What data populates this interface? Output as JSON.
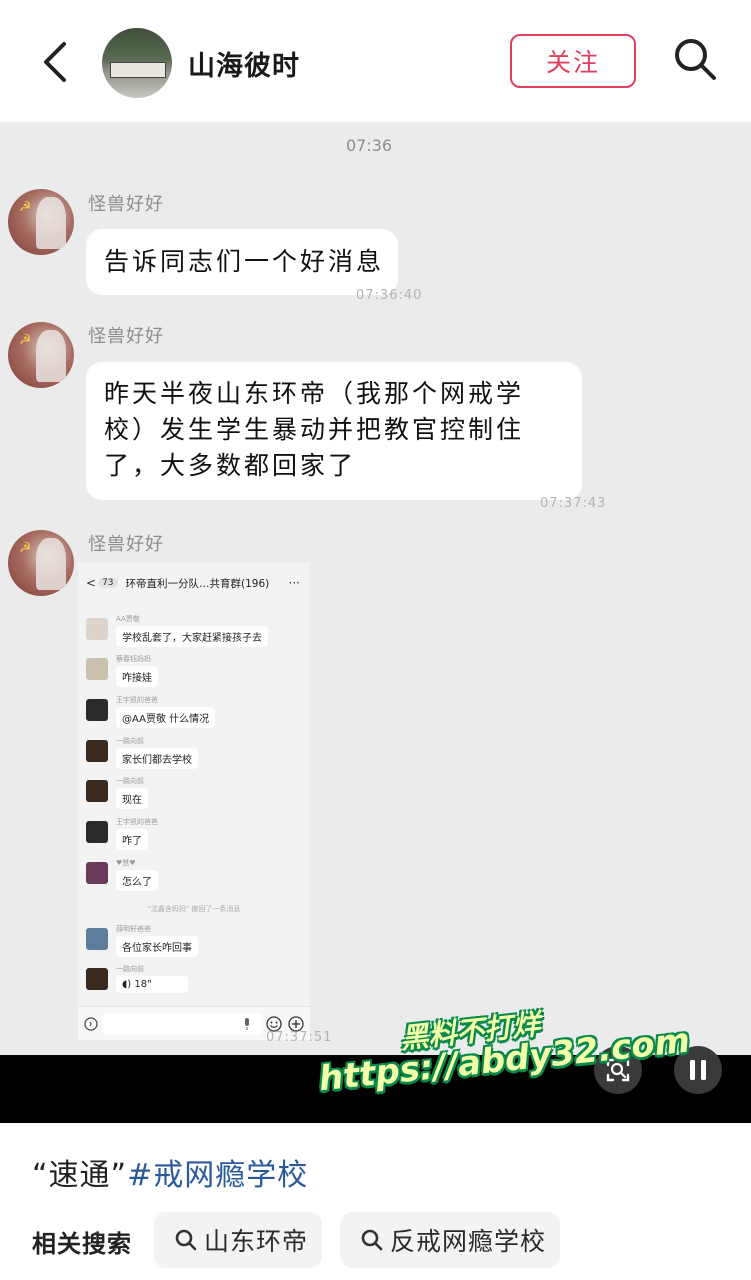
{
  "header": {
    "author_name": "山海彼时",
    "follow_label": "关注"
  },
  "chat": {
    "top_time": "07:36",
    "messages": [
      {
        "sender": "怪兽好好",
        "text": "告诉同志们一个好消息",
        "time": "07:36:40"
      },
      {
        "sender": "怪兽好好",
        "lines": [
          "昨天半夜山东环帝（我那个网戒学",
          "校）发生学生暴动并把教官控制住",
          "了，大多数都回家了"
        ],
        "time": "07:37:43"
      },
      {
        "sender": "怪兽好好",
        "time": "07:37:51"
      }
    ],
    "nested": {
      "back_glyph": "<",
      "unread": "73",
      "title": "环帝直利一分队…共育群(196)",
      "more_glyph": "···",
      "rows": [
        {
          "name": "AA贾敬",
          "text": "学校乱套了，大家赶紧接孩子去"
        },
        {
          "name": "蔡春钰妈妈",
          "text": "咋接娃"
        },
        {
          "name": "王宇凯的爸爸",
          "text": "@AA贾敬 什么情况"
        },
        {
          "name": "一路向前",
          "text": "家长们都去学校"
        },
        {
          "name": "一路向前",
          "text": "现在"
        },
        {
          "name": "王宇凯的爸爸",
          "text": "咋了"
        },
        {
          "name": "♥慧♥",
          "text": "怎么了"
        },
        {
          "name": "薛明轩爸爸",
          "text": "各位家长咋回事"
        },
        {
          "name": "一路向前",
          "text": "18\""
        }
      ],
      "notice": "\"沈鑫含妈妈\" 撤回了一条消息"
    }
  },
  "watermark": {
    "line1": "黑料不打烊",
    "line2": "https://abdy32.com"
  },
  "post": {
    "caption_quote": "“速通”",
    "caption_tag": "#戒网瘾学校"
  },
  "related": {
    "label": "相关搜索",
    "chips": [
      "山东环帝",
      "反戒网瘾学校"
    ]
  },
  "icons": [
    "back-icon",
    "search-icon",
    "screen-capture-icon",
    "pause-icon",
    "voice-icon",
    "mic-icon",
    "emoji-icon",
    "plus-icon"
  ],
  "colors": {
    "follow": "#e0405e",
    "tag": "#2a5a9a",
    "chat_bg": "#ebebeb"
  }
}
